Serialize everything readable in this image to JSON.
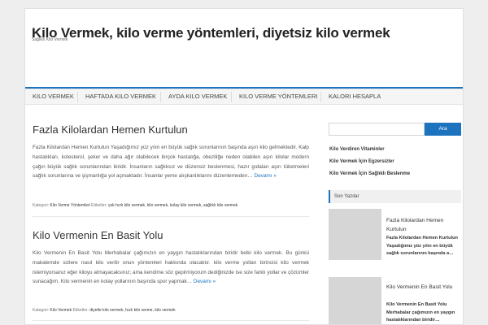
{
  "site": {
    "title": "Kilo Vermek, kilo verme yöntemleri, diyetsiz kilo vermek",
    "description": "Sağlıklı Kilo Vermek"
  },
  "nav": {
    "items": [
      {
        "label": "Kilo Vermek"
      },
      {
        "label": "Haftada Kilo Vermek"
      },
      {
        "label": "Ayda Kilo Vermek"
      },
      {
        "label": "Kilo Verme Yöntemleri"
      },
      {
        "label": "Kalori Hesapla"
      }
    ]
  },
  "posts": [
    {
      "title": "Fazla Kilolardan Hemen Kurtulun",
      "excerpt": "Fazla Kilolardan Hemen Kurtulun Yaşadığımız yüz yılın en büyük sağlık sorunlarının başında aşırı kilo gelmektedir. Kalp hastalıkları, kolesterol, şeker ve daha ağır olabilecek birçok hastalığa, obeziliğe neden olabilen aşırı kilolar modern çağın büyük sağlık sorunlarından biridir. İnsanların sağlıksız ve düzensiz beslenmesi, hazır gıdaları aşırı tüketmeleri sağlık sorunlarına ve şişmanlığa yol açmaktadır. İnsanlar yeme alışkanlıklarını düzenlemeden…",
      "more": "Devamı »",
      "meta_category_label": "Kategori:",
      "meta_category": "Kilo Verme Yöntemleri",
      "meta_tags_label": "Etiketler:",
      "meta_tags": "çok hızlı kilo vermek, kilo vermek, kolay kilo vermek, sağlıklı kilo vermek"
    },
    {
      "title": "Kilo Vermenin En Basit Yolu",
      "excerpt": "Kilo Vermenin En Basit Yolu   Merhabalar çağımızın en yaygın hastalıklarından biridir belki kilo vermek. Bu günkü makalemde sizlere nasıl kilo verilir onun yöntemleri hakkında olacaktır. kilo verme yolları birincisi kilo vermek istemiyorsanız eğer kiloyu almayacaksınız; ama kendime söz gepirmiyorum dediğinizde ise size farklı yollar ve çözümler sunacağım. Kilo vermenin en kolay yollarının başında spor yapmak…",
      "more": "Devamı »",
      "meta_category_label": "Kategori:",
      "meta_category": "Kilo Vermek",
      "meta_tags_label": "Etiketler:",
      "meta_tags": "diyetle kilo vermek, hızlı kilo verme, kilo vermek"
    }
  ],
  "sidebar": {
    "search": {
      "placeholder": "",
      "button": "Ara"
    },
    "links": [
      {
        "label": "Kilo Verdiren Vitaminler"
      },
      {
        "label": "Kilo Vermek İçin Egzersizler"
      },
      {
        "label": "Kilo Vermek İçin Sağlıklı Beslenme"
      }
    ],
    "recent_heading": "Son Yazılar",
    "recent": [
      {
        "title": "Fazla Kilolardan Hemen Kurtulun",
        "excerpt": "Fazla Kilolardan Hemen Kurtulun Yaşadığımız yüz yılın en büyük sağlık sorunlarının başında a…"
      },
      {
        "title": "Kilo Vermenin En Basit Yolu",
        "excerpt": "Kilo Vermenin En Basit Yolu   Merhabalar çağımızın en yaygın hastalıklarından biridir…"
      }
    ]
  },
  "colors": {
    "accent": "#1e73be",
    "background": "#eeeeee",
    "panel": "#ffffff"
  }
}
